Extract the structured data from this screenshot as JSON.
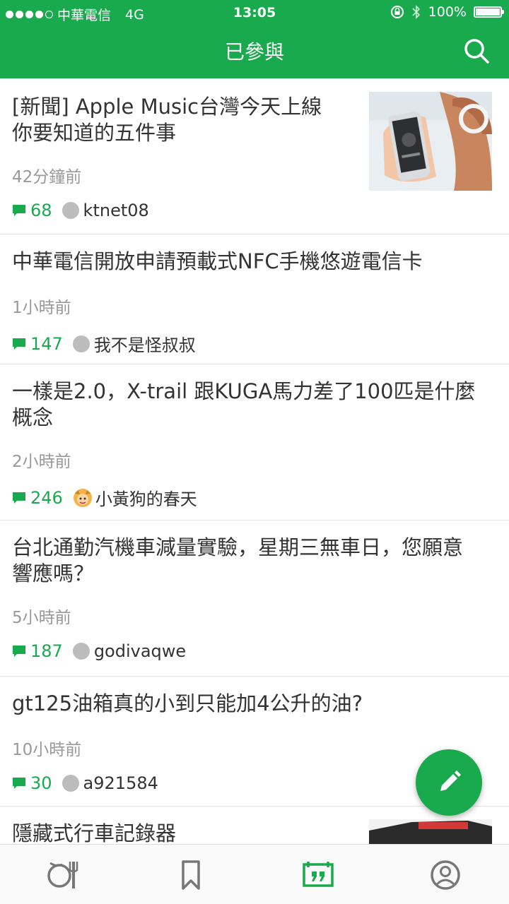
{
  "status_bar": {
    "carrier": "中華電信",
    "network": "4G",
    "time": "13:05",
    "battery": "100%",
    "battery_level": 1.0
  },
  "header": {
    "title": "已參與",
    "search_icon": "search-icon"
  },
  "colors": {
    "brand": "#1aaa4e",
    "muted": "#999999"
  },
  "posts": [
    {
      "title": "[新聞] Apple Music台灣今天上線\n 你要知道的五件事",
      "time": "42分鐘前",
      "comments": "68",
      "author": "ktnet08",
      "thumbnail": true
    },
    {
      "title": "中華電信開放申請預載式NFC手機悠遊電信卡",
      "time": "1小時前",
      "comments": "147",
      "author": "我不是怪叔叔",
      "thumbnail": false
    },
    {
      "title": "一樣是2.0，X-trail 跟KUGA馬力差了100匹是什麼概念",
      "time": "2小時前",
      "comments": "246",
      "author": "小黃狗的春天",
      "thumbnail": false
    },
    {
      "title": "台北通勤汽機車減量實驗，星期三無車日，您願意響應嗎？",
      "time": "5小時前",
      "comments": "187",
      "author": "godivaqwe",
      "thumbnail": false
    },
    {
      "title": "gt125油箱真的小到只能加4公升的油?",
      "time": "10小時前",
      "comments": "30",
      "author": "a921584",
      "thumbnail": false
    },
    {
      "title": "隱藏式行車記錄器",
      "time": "",
      "comments": "",
      "author": "",
      "thumbnail": true
    }
  ],
  "fab": {
    "icon": "pencil-icon"
  },
  "tabs": [
    {
      "icon": "dining-icon",
      "active": false
    },
    {
      "icon": "bookmark-icon",
      "active": false
    },
    {
      "icon": "quote-icon",
      "active": true
    },
    {
      "icon": "profile-icon",
      "active": false
    }
  ]
}
